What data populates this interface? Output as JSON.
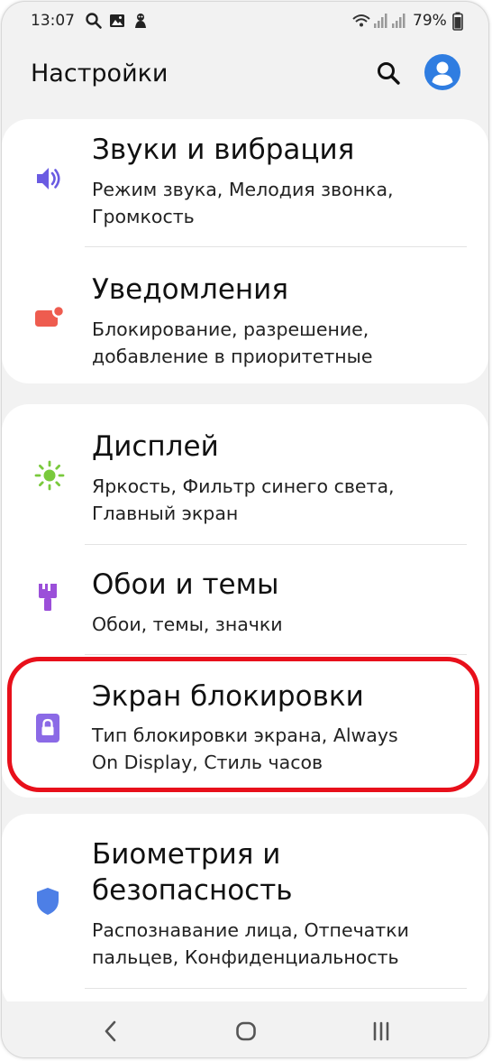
{
  "status_bar": {
    "time": "13:07",
    "battery_percent": "79%",
    "icons": [
      "search-icon",
      "gallery-icon",
      "mascot-icon",
      "wifi-icon",
      "signal-icon",
      "signal-icon",
      "battery-icon"
    ]
  },
  "header": {
    "title": "Настройки",
    "search_icon": "search-icon",
    "avatar_icon": "account-icon"
  },
  "settings": [
    {
      "icon": "sound-icon",
      "icon_color": "#6a5be2",
      "title": "Звуки и вибрация",
      "subtitle": "Режим звука, Мелодия звонка,\nГромкость"
    },
    {
      "icon": "notifications-icon",
      "icon_color": "#ee5c4f",
      "title": "Уведомления",
      "subtitle": "Блокирование, разрешение,\nдобавление в приоритетные"
    },
    {
      "icon": "display-icon",
      "icon_color": "#79c93c",
      "title": "Дисплей",
      "subtitle": "Яркость, Фильтр синего света,\nГлавный экран"
    },
    {
      "icon": "wallpaper-icon",
      "icon_color": "#9b4fd9",
      "title": "Обои и темы",
      "subtitle": "Обои, темы, значки"
    },
    {
      "icon": "lock-icon",
      "icon_color": "#8b6ae6",
      "title": "Экран блокировки",
      "subtitle": "Тип блокировки экрана, Always\nOn Display, Стиль часов",
      "highlighted": true
    },
    {
      "icon": "shield-icon",
      "icon_color": "#4d7fe6",
      "title": "Биометрия и\nбезопасность",
      "subtitle": "Распознавание лица, Отпечатки\nпальцев, Конфиденциальность"
    }
  ],
  "highlight_color": "#e8101b",
  "nav_bar": [
    "back-icon",
    "home-icon",
    "recents-icon"
  ]
}
